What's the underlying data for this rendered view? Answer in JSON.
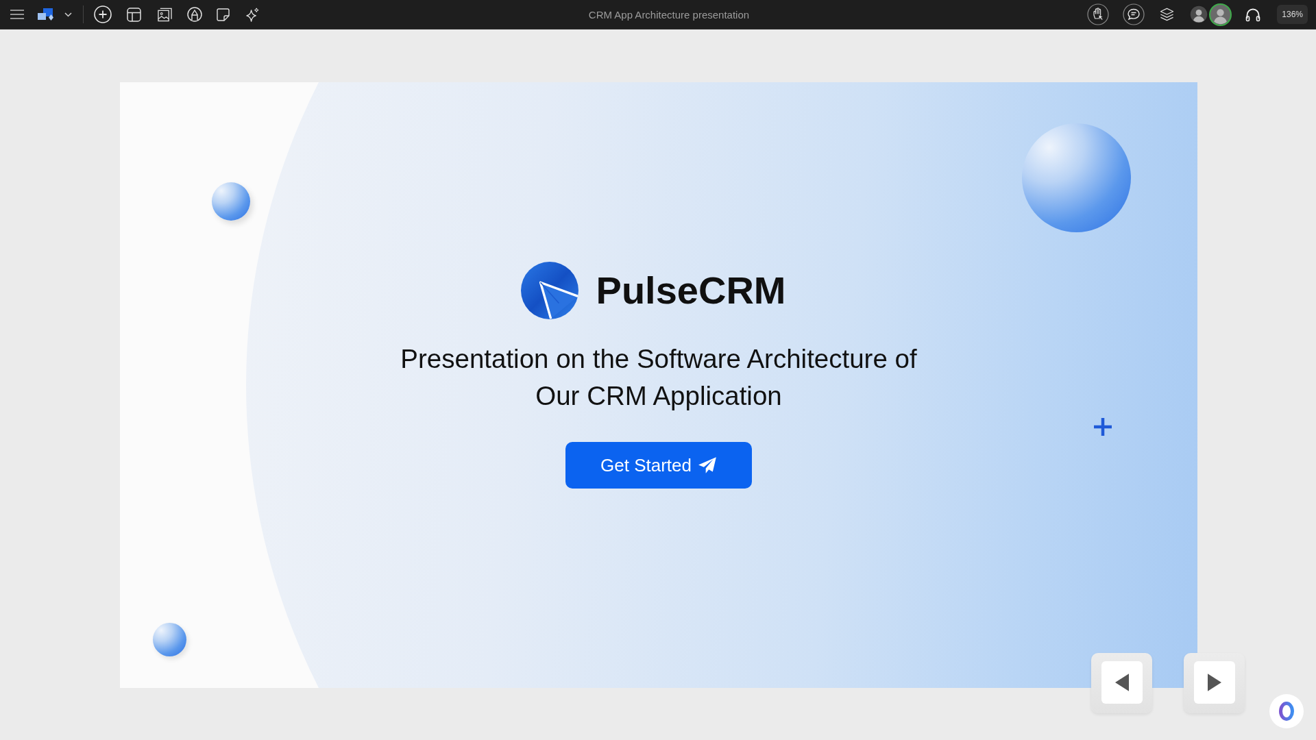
{
  "top_bar": {
    "title": "CRM App Architecture presentation",
    "collaborators": [
      {
        "active": false
      },
      {
        "active": true
      }
    ],
    "zoom": "136%"
  },
  "slide": {
    "brand": "PulseCRM",
    "subtitle": "Presentation on the Software Architecture of\nOur CRM Application",
    "button": "Get Started"
  }
}
